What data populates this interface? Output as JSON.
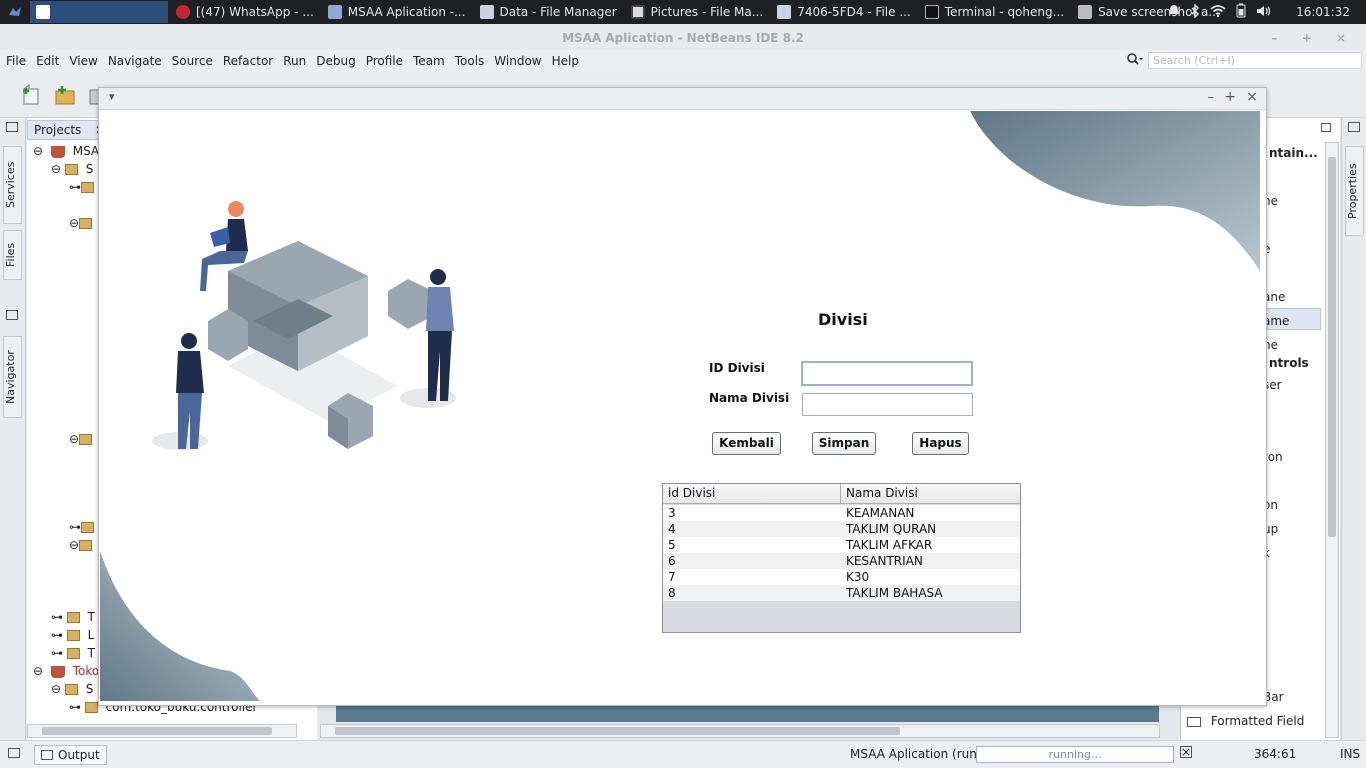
{
  "taskbar": {
    "tasks": [
      {
        "label": ""
      },
      {
        "label": "[(47) WhatsApp - ..."
      },
      {
        "label": "MSAA Aplication -..."
      },
      {
        "label": "Data - File Manager"
      },
      {
        "label": "Pictures - File Ma..."
      },
      {
        "label": "7406-5FD4 - File ..."
      },
      {
        "label": "Terminal - qoheng..."
      },
      {
        "label": "Save screenshot a..."
      }
    ],
    "clock": "16:01:32"
  },
  "netbeans": {
    "title": "MSAA Aplication - NetBeans IDE 8.2",
    "menu": [
      "File",
      "Edit",
      "View",
      "Navigate",
      "Source",
      "Refactor",
      "Run",
      "Debug",
      "Profile",
      "Team",
      "Tools",
      "Window",
      "Help"
    ],
    "search_placeholder": "Search (Ctrl+I)",
    "left_tabs": [
      "Services",
      "Files",
      "Navigator"
    ],
    "right_tabs": [
      "Properties"
    ],
    "projects_tab": "Projects",
    "tree": [
      {
        "label": "MSAA"
      },
      {
        "label": "S"
      },
      {
        "label": "T"
      },
      {
        "label": "L"
      },
      {
        "label": "T"
      },
      {
        "label": "Toko"
      },
      {
        "label": "S"
      },
      {
        "label": "com.toko_buku.controller"
      }
    ],
    "palette": {
      "headers": [
        "ntain...",
        "ntrols"
      ],
      "items": [
        "ne",
        "e",
        "ane",
        "ame",
        "ne",
        "ser",
        "ton",
        "on",
        "up",
        "k",
        "Bar",
        "Formatted Field"
      ]
    }
  },
  "status": {
    "output_label": "Output",
    "run_label": "MSAA Aplication (run)",
    "progress_label": "running...",
    "cursor_pos": "364:61",
    "insert_mode": "INS"
  },
  "form": {
    "title": "Divisi",
    "id_label": "ID Divisi",
    "id_value": "",
    "nama_label": "Nama Divisi",
    "nama_value": "",
    "buttons": {
      "back": "Kembali",
      "save": "Simpan",
      "delete": "Hapus"
    },
    "table": {
      "columns": [
        "id Divisi",
        "Nama Divisi"
      ],
      "rows": [
        [
          "3",
          "KEAMANAN"
        ],
        [
          "4",
          "TAKLIM QURAN"
        ],
        [
          "5",
          "TAKLIM AFKAR"
        ],
        [
          "6",
          "KESANTRIAN"
        ],
        [
          "7",
          "K30"
        ],
        [
          "8",
          "TAKLIM BAHASA"
        ]
      ]
    }
  },
  "colors": {
    "accent_shape": "#7f97a4",
    "taskbar": "#1f2024",
    "active_task": "#2c4f7c"
  }
}
